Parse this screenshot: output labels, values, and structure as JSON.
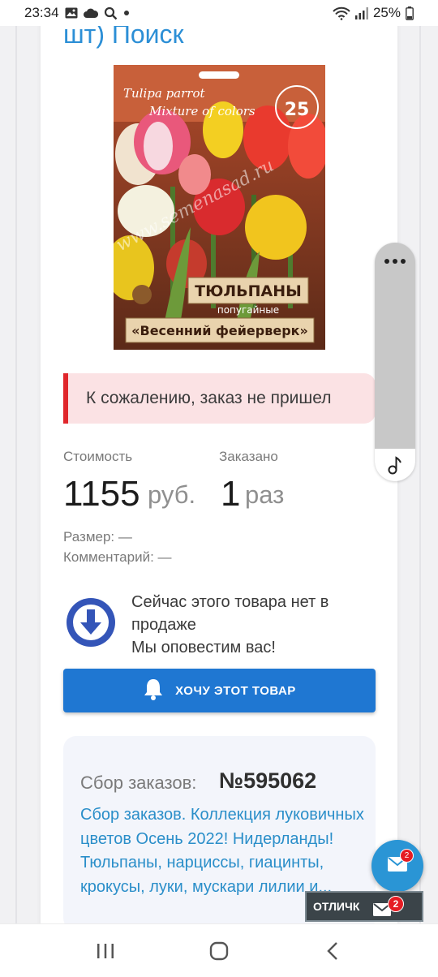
{
  "status_bar": {
    "time": "23:34",
    "battery": "25%"
  },
  "header": {
    "title": "шт) Поиск"
  },
  "product": {
    "image_texts": {
      "latin_line1": "Tulipa parrot",
      "latin_line2": "Mixture of colors",
      "watermark": "www.semenasad.ru",
      "name": "ТЮЛЬПАНЫ",
      "subtype": "попугайные",
      "variety": "«Весенний фейерверк»",
      "count": "25"
    }
  },
  "alert": {
    "text": "К сожалению, заказ не пришел"
  },
  "order": {
    "cost_label": "Стоимость",
    "cost_value": "1155",
    "cost_unit": "руб.",
    "ordered_label": "Заказано",
    "ordered_value": "1",
    "ordered_unit": "раз",
    "size_line": "Размер: —",
    "comment_line": "Комментарий: —"
  },
  "availability": {
    "line1": "Сейчас этого товара нет в продаже",
    "line2": "Мы оповестим вас!"
  },
  "want_button": {
    "label": "ХОЧУ ЭТОТ ТОВАР"
  },
  "collection": {
    "label": "Сбор заказов:",
    "number": "№595062",
    "description": "Сбор заказов. Коллекция луковичных цветов Осень 2022! Нидерланды! Тюльпаны, нарциссы, гиацинты, крокусы, луки, мускари лилии и..."
  },
  "chat": {
    "badge_count": "2"
  },
  "bottom_bar": {
    "label": "ОТЛИЧК",
    "badge_count": "2"
  },
  "colors": {
    "accent": "#1f77d2",
    "link": "#2a8ec9",
    "alert_bg": "#fbe2e4",
    "alert_border": "#e0262b",
    "notify_circle": "#3455b8",
    "fab": "#2a95d5"
  },
  "icons": [
    "image-icon",
    "cloud-icon",
    "search-icon",
    "wifi-icon",
    "signal-icon",
    "battery-icon",
    "more-dots-icon",
    "music-note-icon",
    "arrow-down-circle-icon",
    "bell-icon",
    "mail-icon",
    "recents-icon",
    "home-icon",
    "back-icon"
  ]
}
